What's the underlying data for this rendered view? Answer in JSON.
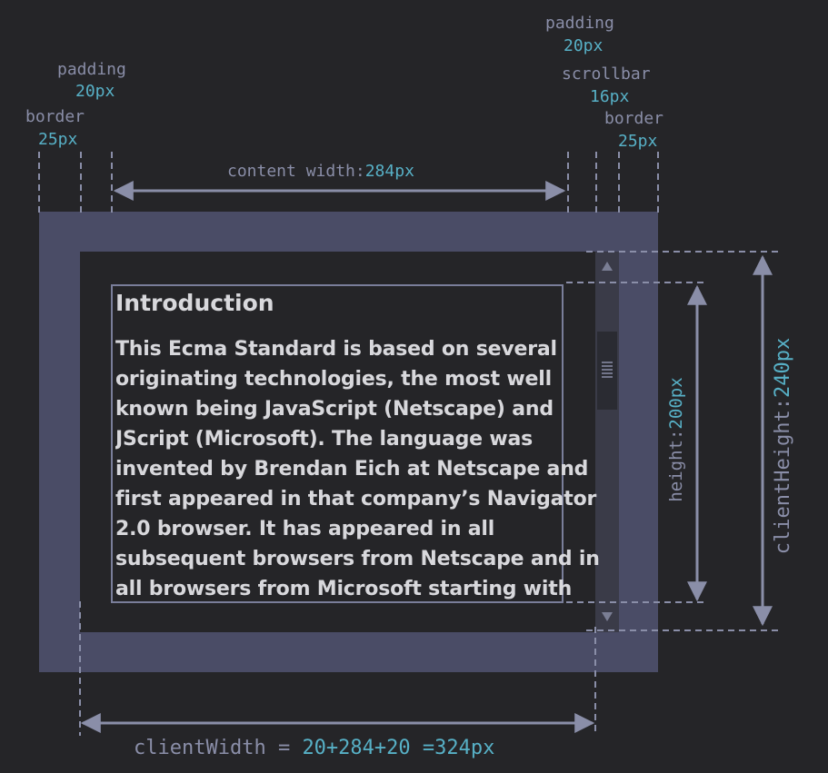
{
  "labels": {
    "padding_left": {
      "name": "padding",
      "value": "20px"
    },
    "border_left": {
      "name": "border",
      "value": "25px"
    },
    "padding_right": {
      "name": "padding",
      "value": "20px"
    },
    "scrollbar": {
      "name": "scrollbar",
      "value": "16px"
    },
    "border_right": {
      "name": "border",
      "value": "25px"
    },
    "content_width": {
      "name": "content width:",
      "value": "284px"
    },
    "height": {
      "name": "height:",
      "value": "200px"
    },
    "client_height": {
      "name": "clientHeight:",
      "value": "240px"
    },
    "client_width": {
      "name": "clientWidth = ",
      "value": "20+284+20 =324px"
    }
  },
  "content": {
    "heading": "Introduction",
    "paragraph": "This Ecma Standard is based on several originating technologies, the most well known being JavaScript (Netscape) and JScript (Microsoft). The language was invented by Brendan Eich at Netscape and first appeared in that company’s Navigator 2.0 browser. It has appeared in all subsequent browsers from Netscape and in all browsers from Microsoft starting with"
  },
  "colors": {
    "background": "#252528",
    "border": "#4a4c66",
    "label": "#8a8ea8",
    "value": "#57b0c6",
    "text": "#d8d8dc"
  }
}
